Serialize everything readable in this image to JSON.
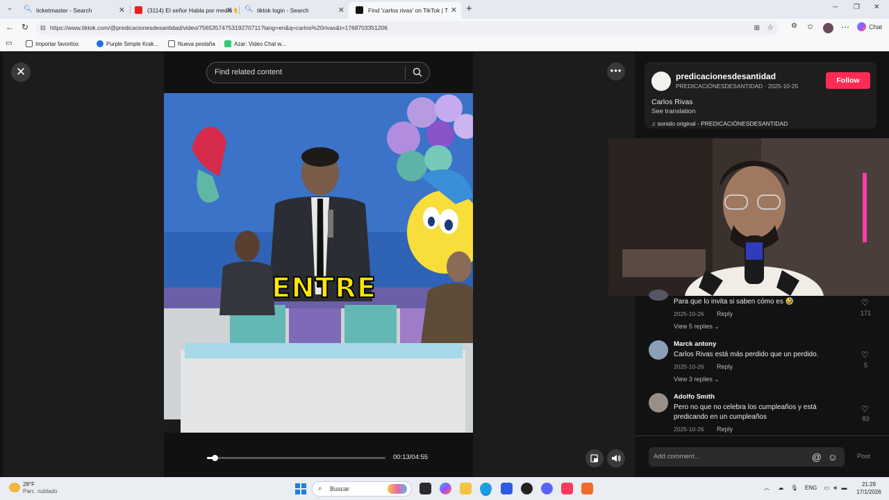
{
  "browser": {
    "tabs": [
      {
        "label": "ticketmaster - Search",
        "active": false
      },
      {
        "label": "(3114) El señor Habla por medio 😪",
        "active": false
      },
      {
        "label": "tiktok login - Search",
        "active": false
      },
      {
        "label": "Find 'carlos rivas' on TikTok | T",
        "active": true
      }
    ],
    "new_tab": "+",
    "url": "https://www.tiktok.com/@predicacionesdesantidad/video/7565357475319270711?lang=en&q=carlos%20rivas&t=1768703351206",
    "chat_label": "Chat",
    "bookmarks": [
      "Importar favoritos",
      "Purple Simple Krak...",
      "Nueva pestaña",
      "Azar: Video Chat w..."
    ]
  },
  "player": {
    "close_label": "✕",
    "search_placeholder": "Find related content",
    "more_label": "•••",
    "overlay_text": "ENTRE",
    "time": "00:13/04:55",
    "progress_fraction": 0.044
  },
  "author": {
    "username": "predicacionesdesantidad",
    "subline": "PREDICACIÓNESDESANTIDAD · 2025-10-25",
    "follow_label": "Follow",
    "caption": "Carlos Rivas",
    "see_translation": "See translation",
    "sound": "sonido original - PREDICACIÓNESDESANTIDAD"
  },
  "comments": [
    {
      "name": "",
      "text": "Para que lo invita si saben cómo es 🤣",
      "date": "2025-10-26",
      "reply": "Reply",
      "likes": "171",
      "view_replies": "View 5 replies ⌄"
    },
    {
      "name": "Marck antony",
      "text": "Carlos Rivas está más perdido que un perdido.",
      "date": "2025-10-26",
      "reply": "Reply",
      "likes": "5",
      "view_replies": "View 3 replies ⌄"
    },
    {
      "name": "Adolfo Smith",
      "text": "Pero no que no celebra los cumpleaños y está predicando en un cumpleaños",
      "date": "2025-10-26",
      "reply": "Reply",
      "likes": "83",
      "view_replies": ""
    }
  ],
  "composer": {
    "placeholder": "Add comment...",
    "at": "@",
    "emoji": "☺",
    "post": "Post"
  },
  "taskbar": {
    "temp": "28°F",
    "weather": "Parc. nublado",
    "search": "Buscar",
    "lang": "ENG",
    "time": "21:29",
    "date": "17/1/2026"
  },
  "icons": {
    "accent": "#fe2c55"
  }
}
